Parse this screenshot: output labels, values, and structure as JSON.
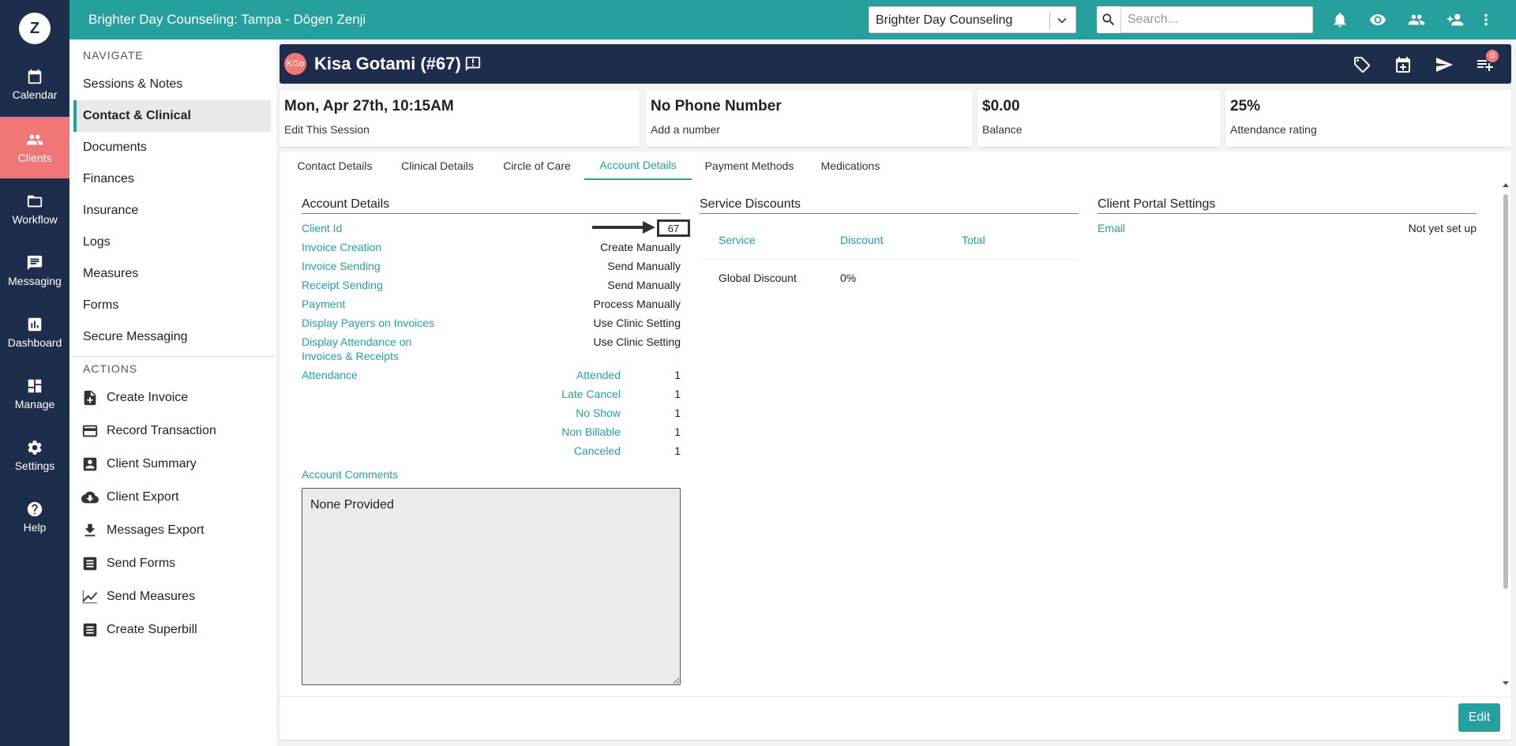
{
  "rail": {
    "logo": "Z",
    "items": [
      {
        "label": "Calendar",
        "icon": "calendar-icon"
      },
      {
        "label": "Clients",
        "icon": "clients-icon",
        "active": true
      },
      {
        "label": "Workflow",
        "icon": "folder-icon"
      },
      {
        "label": "Messaging",
        "icon": "message-icon"
      },
      {
        "label": "Dashboard",
        "icon": "dashboard-icon"
      },
      {
        "label": "Manage",
        "icon": "manage-icon"
      },
      {
        "label": "Settings",
        "icon": "gear-icon"
      },
      {
        "label": "Help",
        "icon": "help-icon"
      }
    ]
  },
  "topbar": {
    "title": "Brighter Day Counseling: Tampa - Dōgen Zenji",
    "clinic_select": "Brighter Day Counseling",
    "search_placeholder": "Search..."
  },
  "subnav": {
    "navigate_heading": "NAVIGATE",
    "items": [
      "Sessions & Notes",
      "Contact & Clinical",
      "Documents",
      "Finances",
      "Insurance",
      "Logs",
      "Measures",
      "Forms",
      "Secure Messaging"
    ],
    "active_item": "Contact & Clinical",
    "actions_heading": "ACTIONS",
    "actions": [
      "Create Invoice",
      "Record Transaction",
      "Client Summary",
      "Client Export",
      "Messages Export",
      "Send Forms",
      "Send Measures",
      "Create Superbill"
    ]
  },
  "client": {
    "initials": "KGo",
    "name": "Kisa Gotami (#67)",
    "notification_count": "0"
  },
  "cards": [
    {
      "big": "Mon, Apr 27th, 10:15AM",
      "small": "Edit This Session"
    },
    {
      "big": "No Phone Number",
      "small": "Add a number"
    },
    {
      "big": "$0.00",
      "small": "Balance"
    },
    {
      "big": "25%",
      "small": "Attendance rating"
    }
  ],
  "tabs": [
    "Contact Details",
    "Clinical Details",
    "Circle of Care",
    "Account Details",
    "Payment Methods",
    "Medications"
  ],
  "active_tab": "Account Details",
  "account": {
    "title": "Account Details",
    "rows": [
      {
        "label": "Client Id",
        "value": "67"
      },
      {
        "label": "Invoice Creation",
        "value": "Create Manually"
      },
      {
        "label": "Invoice Sending",
        "value": "Send Manually"
      },
      {
        "label": "Receipt Sending",
        "value": "Send Manually"
      },
      {
        "label": "Payment",
        "value": "Process Manually"
      },
      {
        "label": "Display Payers on Invoices",
        "value": "Use Clinic Setting"
      },
      {
        "label": "Display Attendance on",
        "label2": "Invoices & Receipts",
        "value": "Use Clinic Setting"
      }
    ],
    "attendance_label": "Attendance",
    "attendance": [
      {
        "label": "Attended",
        "value": "1"
      },
      {
        "label": "Late Cancel",
        "value": "1"
      },
      {
        "label": "No Show",
        "value": "1"
      },
      {
        "label": "Non Billable",
        "value": "1"
      },
      {
        "label": "Canceled",
        "value": "1"
      }
    ],
    "comments_label": "Account Comments",
    "comments": "None Provided"
  },
  "service_discounts": {
    "title": "Service Discounts",
    "headers": [
      "Service",
      "Discount",
      "Total"
    ],
    "row": {
      "service": "Global Discount",
      "discount": "0%",
      "total": ""
    }
  },
  "portal": {
    "title": "Client Portal Settings",
    "email_label": "Email",
    "email_value": "Not yet set up"
  },
  "edit_label": "Edit"
}
